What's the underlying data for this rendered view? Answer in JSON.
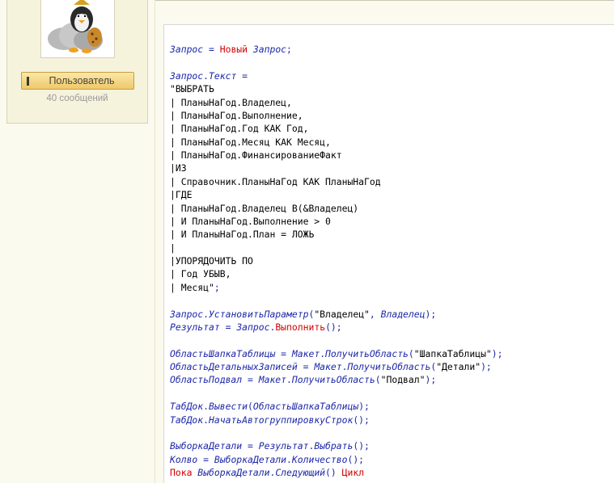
{
  "user": {
    "button_label": "Пользователь",
    "messages": "40 сообщений"
  },
  "colors": {
    "keyword": "#d10000",
    "identifier": "#1d27a8",
    "string": "#000000",
    "button": "#efc869"
  },
  "icons": {
    "avatar": "penguin-avatar-icon"
  },
  "code_lines": [
    [
      [
        "i",
        "Запрос"
      ],
      [
        "p",
        " = "
      ],
      [
        "k",
        "Новый"
      ],
      [
        "i",
        " Запрос"
      ],
      [
        "p",
        ";"
      ]
    ],
    [],
    [
      [
        "i",
        "Запрос"
      ],
      [
        "p",
        "."
      ],
      [
        "i",
        "Текст"
      ],
      [
        "p",
        " ="
      ]
    ],
    [
      [
        "s",
        "\"ВЫБРАТЬ"
      ]
    ],
    [
      [
        "s",
        "| ПланыНаГод.Владелец,"
      ]
    ],
    [
      [
        "s",
        "| ПланыНаГод.Выполнение,"
      ]
    ],
    [
      [
        "s",
        "| ПланыНаГод.Год КАК Год,"
      ]
    ],
    [
      [
        "s",
        "| ПланыНаГод.Месяц КАК Месяц,"
      ]
    ],
    [
      [
        "s",
        "| ПланыНаГод.ФинансированиеФакт"
      ]
    ],
    [
      [
        "s",
        "|ИЗ"
      ]
    ],
    [
      [
        "s",
        "| Справочник.ПланыНаГод КАК ПланыНаГод"
      ]
    ],
    [
      [
        "s",
        "|ГДЕ"
      ]
    ],
    [
      [
        "s",
        "| ПланыНаГод.Владелец В(&Владелец)"
      ]
    ],
    [
      [
        "s",
        "| И ПланыНаГод.Выполнение > 0"
      ]
    ],
    [
      [
        "s",
        "| И ПланыНаГод.План = ЛОЖЬ"
      ]
    ],
    [
      [
        "s",
        "|"
      ]
    ],
    [
      [
        "s",
        "|УПОРЯДОЧИТЬ ПО"
      ]
    ],
    [
      [
        "s",
        "| Год УБЫВ,"
      ]
    ],
    [
      [
        "s",
        "| Месяц\""
      ],
      [
        "p",
        ";"
      ]
    ],
    [],
    [
      [
        "i",
        "Запрос"
      ],
      [
        "p",
        "."
      ],
      [
        "i",
        "УстановитьПараметр"
      ],
      [
        "p",
        "("
      ],
      [
        "s",
        "\"Владелец\""
      ],
      [
        "p",
        ", "
      ],
      [
        "i",
        "Владелец"
      ],
      [
        "p",
        ");"
      ]
    ],
    [
      [
        "i",
        "Результат"
      ],
      [
        "p",
        " = "
      ],
      [
        "i",
        "Запрос"
      ],
      [
        "p",
        "."
      ],
      [
        "k",
        "Выполнить"
      ],
      [
        "p",
        "();"
      ]
    ],
    [],
    [
      [
        "i",
        "ОбластьШапкаТаблицы"
      ],
      [
        "p",
        " = "
      ],
      [
        "i",
        "Макет"
      ],
      [
        "p",
        "."
      ],
      [
        "i",
        "ПолучитьОбласть"
      ],
      [
        "p",
        "("
      ],
      [
        "s",
        "\"ШапкаТаблицы\""
      ],
      [
        "p",
        ");"
      ]
    ],
    [
      [
        "i",
        "ОбластьДетальныхЗаписей"
      ],
      [
        "p",
        " = "
      ],
      [
        "i",
        "Макет"
      ],
      [
        "p",
        "."
      ],
      [
        "i",
        "ПолучитьОбласть"
      ],
      [
        "p",
        "("
      ],
      [
        "s",
        "\"Детали\""
      ],
      [
        "p",
        ");"
      ]
    ],
    [
      [
        "i",
        "ОбластьПодвал"
      ],
      [
        "p",
        " = "
      ],
      [
        "i",
        "Макет"
      ],
      [
        "p",
        "."
      ],
      [
        "i",
        "ПолучитьОбласть"
      ],
      [
        "p",
        "("
      ],
      [
        "s",
        "\"Подвал\""
      ],
      [
        "p",
        ");"
      ]
    ],
    [],
    [
      [
        "i",
        "ТабДок"
      ],
      [
        "p",
        "."
      ],
      [
        "i",
        "Вывести"
      ],
      [
        "p",
        "("
      ],
      [
        "i",
        "ОбластьШапкаТаблицы"
      ],
      [
        "p",
        ");"
      ]
    ],
    [
      [
        "i",
        "ТабДок"
      ],
      [
        "p",
        "."
      ],
      [
        "i",
        "НачатьАвтогруппировкуСтрок"
      ],
      [
        "p",
        "();"
      ]
    ],
    [],
    [
      [
        "i",
        "ВыборкаДетали"
      ],
      [
        "p",
        " = "
      ],
      [
        "i",
        "Результат"
      ],
      [
        "p",
        "."
      ],
      [
        "i",
        "Выбрать"
      ],
      [
        "p",
        "();"
      ]
    ],
    [
      [
        "i",
        "Колво"
      ],
      [
        "p",
        " = "
      ],
      [
        "i",
        "ВыборкаДетали"
      ],
      [
        "p",
        "."
      ],
      [
        "i",
        "Количество"
      ],
      [
        "p",
        "();"
      ]
    ],
    [
      [
        "k",
        "Пока"
      ],
      [
        "i",
        " ВыборкаДетали"
      ],
      [
        "p",
        "."
      ],
      [
        "i",
        "Следующий"
      ],
      [
        "p",
        "() "
      ],
      [
        "k",
        "Цикл"
      ]
    ]
  ]
}
